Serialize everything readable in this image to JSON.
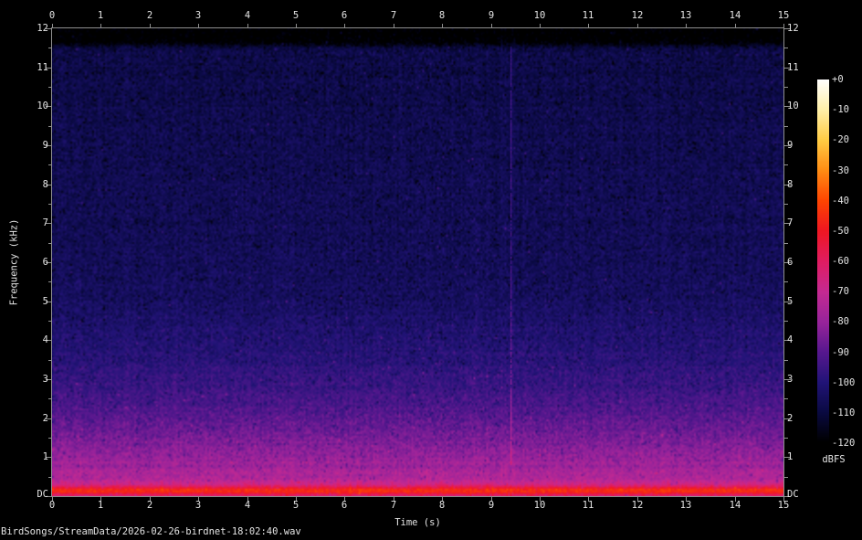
{
  "title": "BirdSongs/StreamData/2026-02-26-birdnet-18:02:40.wav",
  "colors": {
    "background": "#000000",
    "text": "#e4e4e4",
    "axis": "#8f8f8f"
  },
  "chart_data": {
    "type": "heatmap",
    "subtype": "audio-spectrogram",
    "xlabel": "Time (s)",
    "ylabel": "Frequency (kHz)",
    "x_range_s": [
      0,
      15
    ],
    "y_range_khz": [
      0,
      12
    ],
    "x_tick_labels": [
      "0",
      "1",
      "2",
      "3",
      "4",
      "5",
      "6",
      "7",
      "8",
      "9",
      "10",
      "11",
      "12",
      "13",
      "14",
      "15"
    ],
    "y_tick_labels": [
      "12",
      "11",
      "10",
      "9",
      "8",
      "7",
      "6",
      "5",
      "4",
      "3",
      "2",
      "1"
    ],
    "y_minor_tick_step_khz": 0.5,
    "dc_label": "DC",
    "grid": false,
    "legend_position": "right-colorbar",
    "colorbar": {
      "label": "dBFS",
      "range_db": [
        -120,
        0
      ],
      "tick_labels": [
        "+0",
        "-10",
        "-20",
        "-30",
        "-40",
        "-50",
        "-60",
        "-70",
        "-80",
        "-90",
        "-100",
        "-110",
        "-120"
      ],
      "palette": [
        {
          "db": 0,
          "color": "#ffffff"
        },
        {
          "db": -10,
          "color": "#fff0a8"
        },
        {
          "db": -20,
          "color": "#ffcc44"
        },
        {
          "db": -30,
          "color": "#ff8c14"
        },
        {
          "db": -40,
          "color": "#fe4502"
        },
        {
          "db": -50,
          "color": "#ef1723"
        },
        {
          "db": -60,
          "color": "#e11d62"
        },
        {
          "db": -70,
          "color": "#c62a92"
        },
        {
          "db": -80,
          "color": "#99249b"
        },
        {
          "db": -90,
          "color": "#58188f"
        },
        {
          "db": -100,
          "color": "#221478"
        },
        {
          "db": -110,
          "color": "#0a0a42"
        },
        {
          "db": -120,
          "color": "#000000"
        }
      ]
    },
    "noise_floor_profile_khz_db": [
      [
        12.0,
        -122
      ],
      [
        11.68,
        -122
      ],
      [
        11.5,
        -109
      ],
      [
        9.0,
        -107.5
      ],
      [
        6.0,
        -106
      ],
      [
        4.8,
        -104
      ],
      [
        4.0,
        -101
      ],
      [
        3.4,
        -98.5
      ],
      [
        2.8,
        -95.5
      ],
      [
        2.2,
        -91.5
      ],
      [
        1.8,
        -88
      ],
      [
        1.4,
        -84.5
      ],
      [
        1.05,
        -81
      ],
      [
        0.8,
        -78.5
      ],
      [
        0.6,
        -76.5
      ],
      [
        0.45,
        -74.5
      ],
      [
        0.34,
        -71.5
      ],
      [
        0.27,
        -66
      ],
      [
        0.21,
        -58
      ],
      [
        0.17,
        -50
      ],
      [
        0.14,
        -46
      ],
      [
        0.1,
        -45
      ],
      [
        0.07,
        -48
      ],
      [
        0.04,
        -54
      ],
      [
        0.0,
        -60
      ]
    ],
    "noise_jitter_db": 6.5,
    "features": [
      {
        "type": "broadband-transient",
        "time_s": 9.41,
        "f_low_khz": 0.8,
        "f_high_khz": 11.55,
        "boost_db": 13
      },
      {
        "type": "faint-streak",
        "time_s": 3.77,
        "f_low_khz": 6.9,
        "f_high_khz": 7.9,
        "boost_db": 7
      },
      {
        "type": "faint-tone",
        "f_khz": 11.05,
        "boost_db": 5
      },
      {
        "type": "faint-tone",
        "f_khz": 8.0,
        "boost_db": 4
      },
      {
        "type": "bright-band",
        "f_khz": 0.13,
        "level_db": -45
      }
    ]
  }
}
